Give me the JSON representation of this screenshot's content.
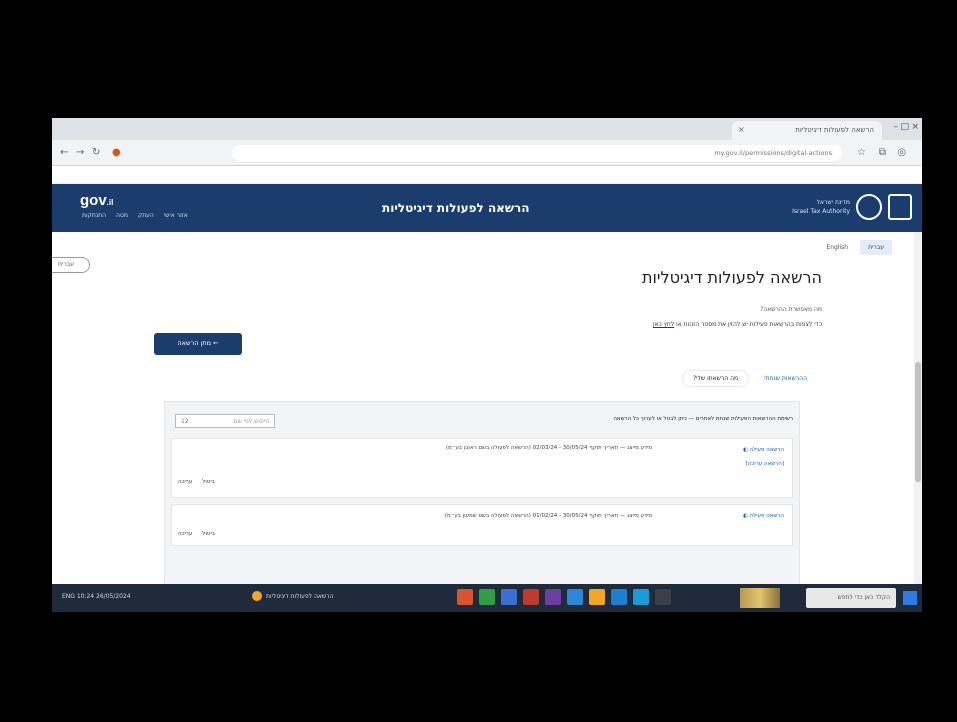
{
  "browser": {
    "tab_title": "הרשאה לפעולות דיגיטליות",
    "tab_close": "×",
    "url": "my.gov.il/permissions/digital-actions",
    "window_controls": [
      "–",
      "□",
      "×"
    ],
    "nav_icons": [
      "back-icon",
      "forward-icon",
      "refresh-icon"
    ]
  },
  "header": {
    "logo": "gov",
    "logo_suffix": ".il",
    "title": "הרשאה לפעולות דיגיטליות",
    "subtitle_line1": "מדינת ישראל",
    "subtitle_line2": "Israel Tax Authority",
    "links": [
      "התנתקות",
      "מטה",
      "העתק",
      "אזור אישי"
    ]
  },
  "lang": {
    "active": "עברית",
    "other": "English"
  },
  "side_pill": "עברית",
  "page": {
    "title": "הרשאה לפעולות דיגיטליות",
    "info_label": "מה מאפשרת ההרשאה?",
    "info_text": "כדי לצפות בהרשאות פעילות יש להזין את מספר הזהות או",
    "info_link": "לחץ כאן",
    "primary_button": "← מתן הרשאה"
  },
  "tabs": [
    {
      "label": "ההרשאות שנתתי",
      "active": false
    },
    {
      "label": "מה הרשאתו שלי?",
      "active": true
    }
  ],
  "panel": {
    "heading": "רשימת ההרשאות הפעילות שנתת לאחרים — ניתן לבטל או לערוך כל הרשאה",
    "search_placeholder": "חיפוש לפי שם",
    "search_count": "12"
  },
  "cards": [
    {
      "status": "הרשאה פעילה ◐",
      "link": "[הרשאה ערוכה]",
      "text": "מידע מייצג — תאריך תוקף 30/05/24 - 02/03/24 (הרשאה לפעולה בשם ראובן בע״מ)",
      "actions": [
        "ביטול",
        "עריכה"
      ]
    },
    {
      "status": "הרשאה פעילה ◐",
      "link": "",
      "text": "מידע מייצג — תאריך תוקף 30/05/24 - 01/02/24 (הרשאה לפעולה בשם שמעון בע״מ)",
      "actions": [
        "ביטול",
        "עריכה"
      ]
    }
  ],
  "taskbar": {
    "search": "הקלד כאן כדי לחפש",
    "left_info": "ENG  10:24  26/05/2024",
    "chrome_label": "הרשאה לפעולות דיגיטליות"
  },
  "colors": {
    "header_bg": "#1a3d6e",
    "accent": "#1a5fb4",
    "taskbar_bg": "#1f2a3a"
  }
}
